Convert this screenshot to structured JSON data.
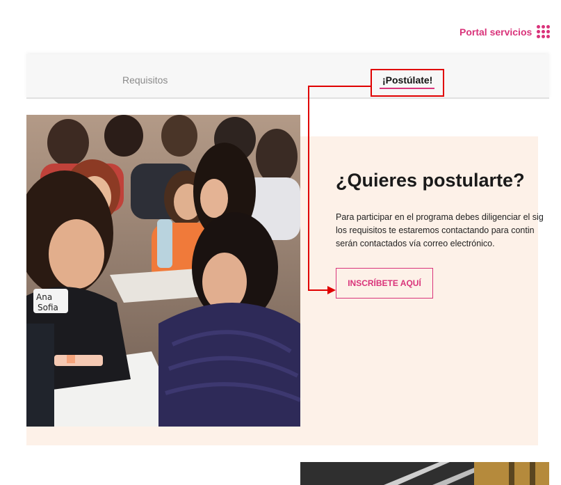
{
  "header": {
    "portal_label": "Portal servicios",
    "portal_icon": "grid-dots-icon",
    "accent": "#d9337a"
  },
  "tabs": [
    {
      "label": "Requisitos",
      "active": false
    },
    {
      "label": "¡Postúlate!",
      "active": true
    }
  ],
  "section": {
    "heading": "¿Quieres postularte?",
    "paragraph_lines": [
      "Para participar en el programa debes diligenciar el sig",
      "los requisitos te estaremos contactando para contin",
      "serán contactados vía correo electrónico."
    ],
    "cta_label": "INSCRÍBETE AQUÍ",
    "background": "#fdf1e8"
  },
  "photo_name_tag": [
    "Ana",
    "Sofia"
  ],
  "annotation_color": "#e00000"
}
